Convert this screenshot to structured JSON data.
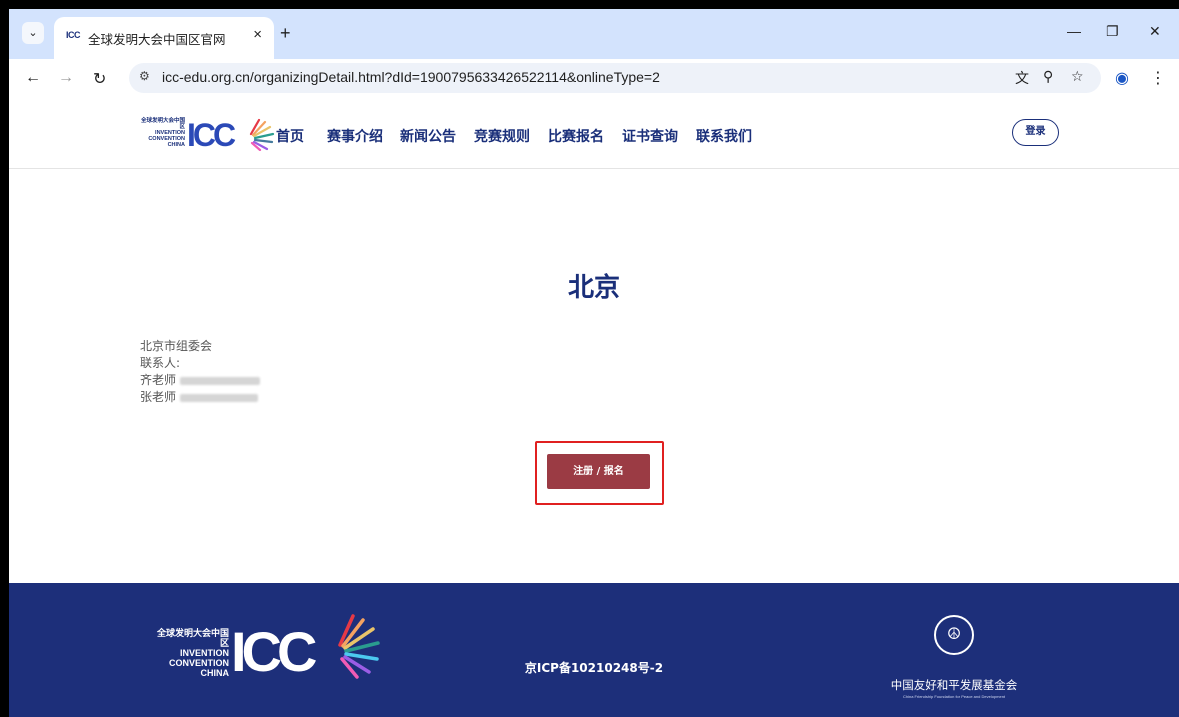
{
  "browser": {
    "tab_title": "全球发明大会中国区官网",
    "tab_favicon_text": "ICC",
    "tab_close": "×",
    "new_tab": "+",
    "url": "icc-edu.org.cn/organizingDetail.html?dId=1900795633426522114&onlineType=2",
    "icons": {
      "back": "back-arrow-icon",
      "forward": "forward-arrow-icon",
      "reload": "reload-icon",
      "site_settings": "tune-icon",
      "translate": "translate-icon",
      "zoom": "zoom-icon",
      "bookmark": "star-icon",
      "profile": "profile-icon",
      "menu": "kebab-menu-icon"
    }
  },
  "header": {
    "logo_text": [
      "全球发明大会中国区",
      "INVENTION",
      "CONVENTION",
      "CHINA"
    ],
    "logo_mark": "ICC",
    "nav": [
      "首页",
      "赛事介绍",
      "新闻公告",
      "竞赛规则",
      "比赛报名",
      "证书查询",
      "联系我们"
    ],
    "login_label": "登录"
  },
  "main": {
    "title": "北京",
    "org": "北京市组委会",
    "contact_label": "联系人:",
    "contacts": [
      {
        "name": "齐老师",
        "phone_redacted": true
      },
      {
        "name": "张老师",
        "phone_redacted": true
      }
    ],
    "register_button": "注册 / 报名"
  },
  "footer": {
    "logo_text": [
      "全球发明大会中国区",
      "INVENTION",
      "CONVENTION",
      "CHINA"
    ],
    "logo_mark": "ICC",
    "icp": "京ICP备10210248号-2",
    "foundation_name": "中国友好和平发展基金会",
    "foundation_sub": "China Friendship Foundation for Peace and Development"
  },
  "colors": {
    "brand_navy": "#1d2f7a",
    "register_button": "#9b3b44",
    "highlight_box": "#e02020",
    "tab_strip": "#d3e3fd"
  }
}
